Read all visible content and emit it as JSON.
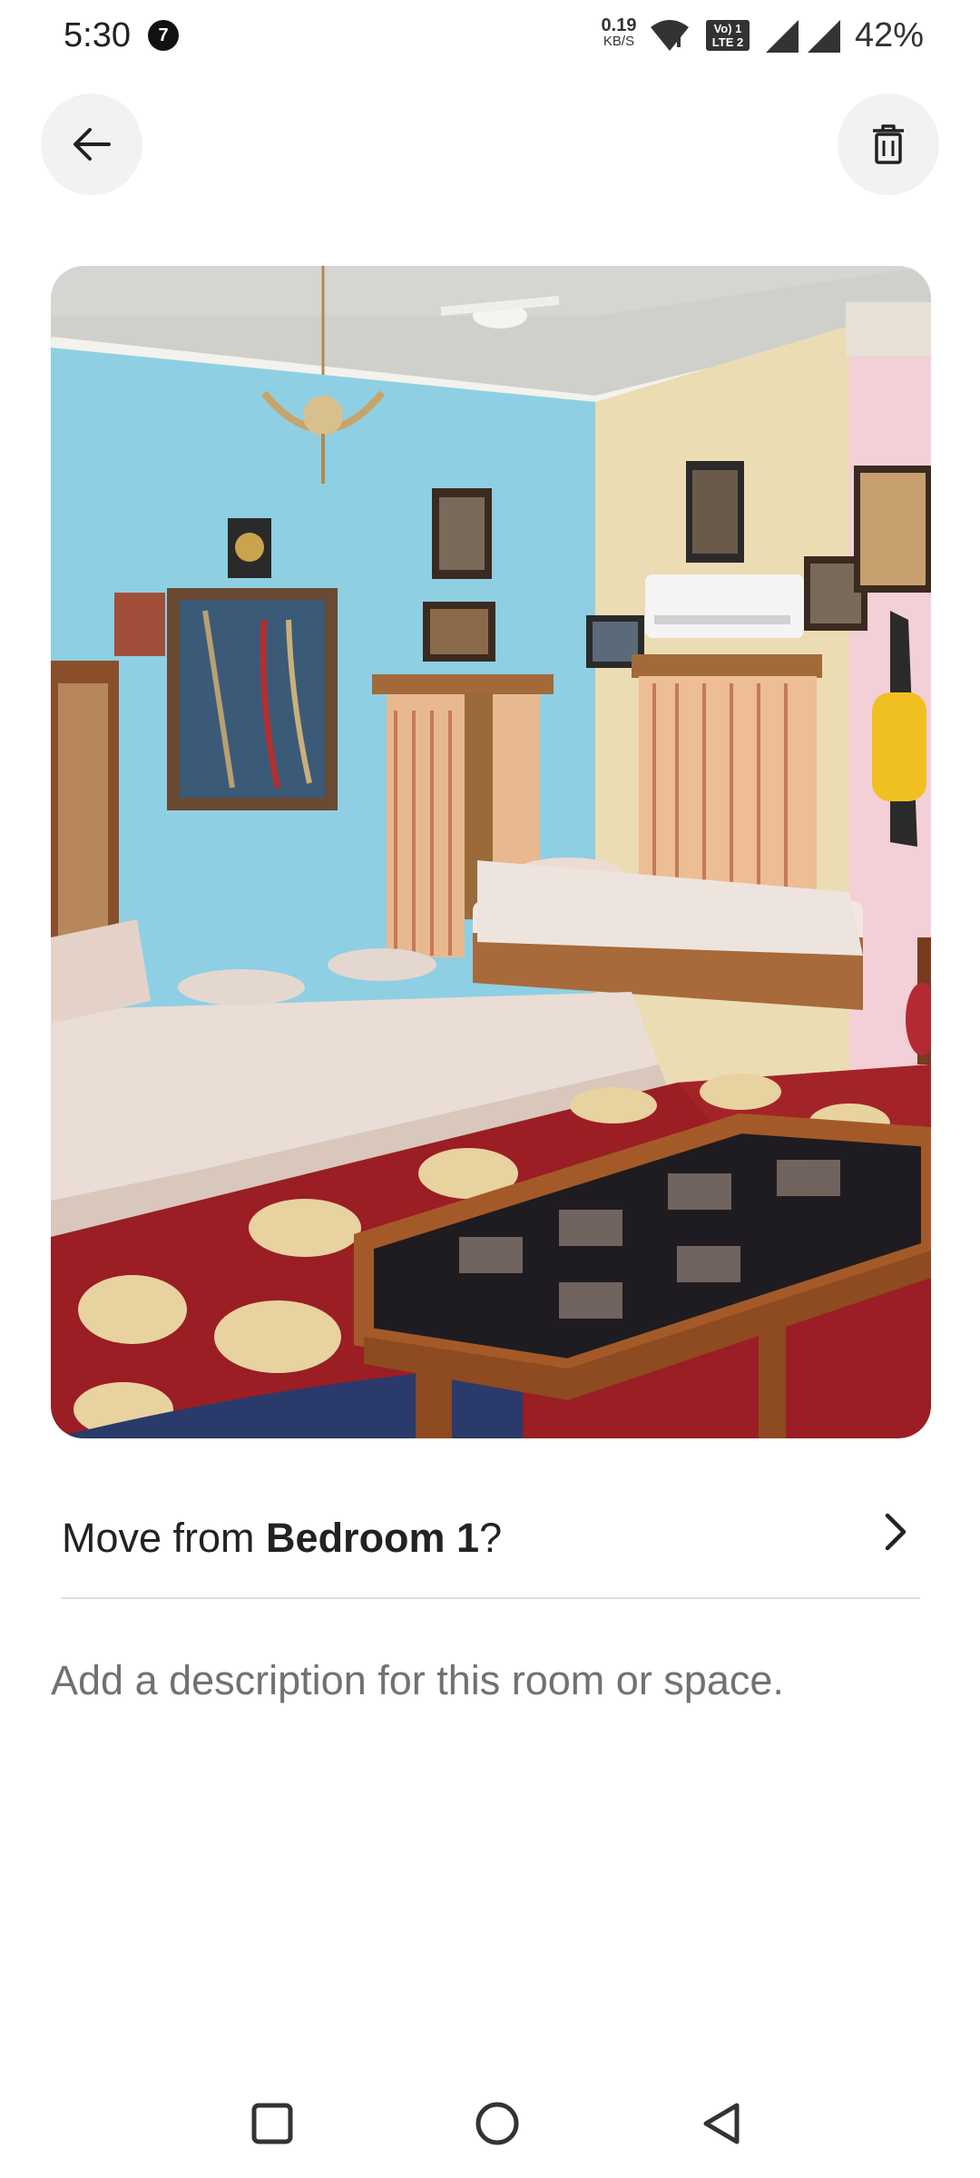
{
  "status_bar": {
    "time": "5:30",
    "notification_count": "7",
    "net_speed_value": "0.19",
    "net_speed_unit": "KB/S",
    "volte_line1": "Vo) 1",
    "volte_line2": "LTE 2",
    "battery": "42%"
  },
  "header": {
    "back_icon": "arrow-left-icon",
    "delete_icon": "trash-icon"
  },
  "photo": {
    "subject": "bedroom photo"
  },
  "move_row": {
    "prefix": "Move from ",
    "room": "Bedroom 1",
    "suffix": "?",
    "icon": "chevron-right-icon"
  },
  "description": {
    "placeholder": "Add a description for this room or space.",
    "value": ""
  },
  "nav_bar": {
    "recent_icon": "square-icon",
    "home_icon": "circle-icon",
    "back_icon": "triangle-back-icon"
  },
  "colors": {
    "text": "#222222",
    "muted": "#717171",
    "button_bg": "#f2f2f2",
    "divider": "#dddddd"
  }
}
